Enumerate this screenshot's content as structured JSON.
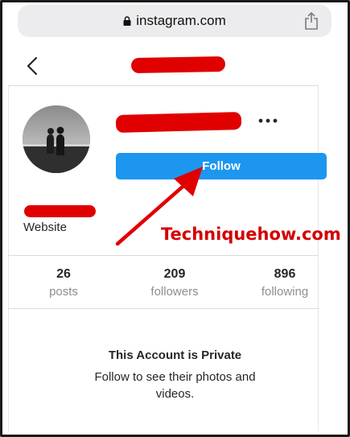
{
  "browser": {
    "url": "instagram.com",
    "icons": {
      "lock": "lock-icon",
      "share": "share-icon"
    }
  },
  "header": {
    "back_icon": "chevron-left-icon",
    "username_redaction_color": "#e00000"
  },
  "profile": {
    "follow_label": "Follow",
    "website_label": "Website",
    "more_icon": "more-horizontal-icon",
    "follow_color": "#1d96f0"
  },
  "stats": [
    {
      "value": "26",
      "label": "posts"
    },
    {
      "value": "209",
      "label": "followers"
    },
    {
      "value": "896",
      "label": "following"
    }
  ],
  "private": {
    "title": "This Account is Private",
    "subtitle": "Follow to see their photos and videos."
  },
  "annotation": {
    "watermark": "Techniquehow.com",
    "arrow_color": "#e00000"
  }
}
